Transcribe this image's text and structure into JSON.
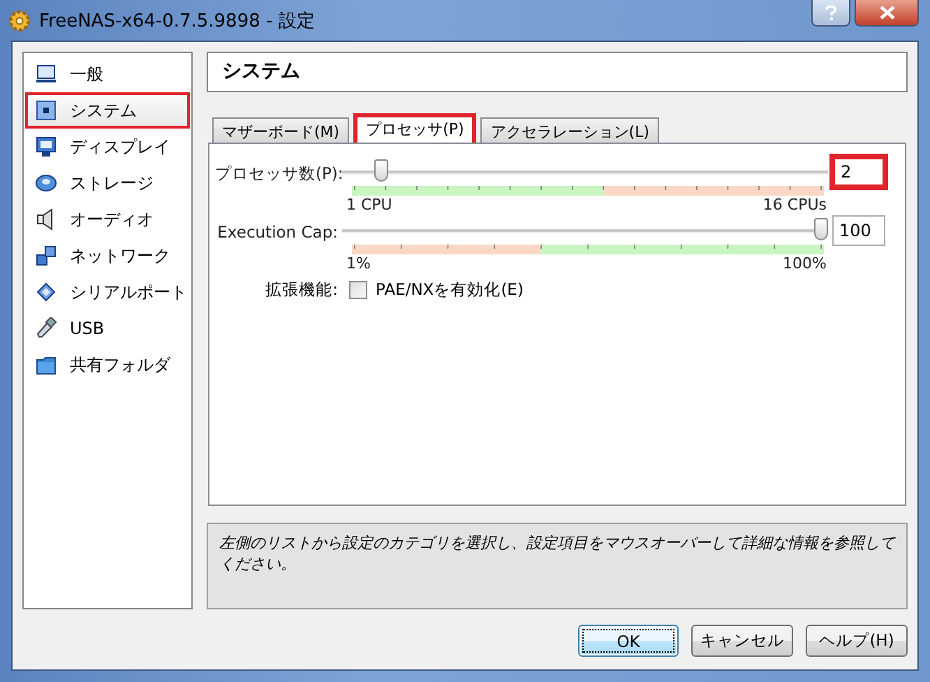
{
  "window": {
    "title": "FreeNAS-x64-0.7.5.9898 - 設定"
  },
  "sidebar": {
    "items": [
      {
        "label": "一般",
        "selected": false,
        "highlighted": false
      },
      {
        "label": "システム",
        "selected": true,
        "highlighted": true
      },
      {
        "label": "ディスプレイ",
        "selected": false,
        "highlighted": false
      },
      {
        "label": "ストレージ",
        "selected": false,
        "highlighted": false
      },
      {
        "label": "オーディオ",
        "selected": false,
        "highlighted": false
      },
      {
        "label": "ネットワーク",
        "selected": false,
        "highlighted": false
      },
      {
        "label": "シリアルポート",
        "selected": false,
        "highlighted": false
      },
      {
        "label": "USB",
        "selected": false,
        "highlighted": false
      },
      {
        "label": "共有フォルダ",
        "selected": false,
        "highlighted": false
      }
    ]
  },
  "page_title": "システム",
  "tabs": [
    {
      "label": "マザーボード(M)",
      "selected": false,
      "highlighted": false
    },
    {
      "label": "プロセッサ(P)",
      "selected": true,
      "highlighted": true
    },
    {
      "label": "アクセラレーション(L)",
      "selected": false,
      "highlighted": false
    }
  ],
  "processor": {
    "rows": [
      {
        "kind": "count",
        "label": "プロセッサ数(P):",
        "level": 0.067,
        "value": "2",
        "highlighted": true,
        "min_label": "1 CPU",
        "max_label": "16 CPUs"
      },
      {
        "kind": "percent",
        "label": "Execution Cap:",
        "level": 1,
        "value": "100",
        "highlighted": false,
        "min_label": "1%",
        "max_label": "100%"
      }
    ],
    "extended": {
      "label": "拡張機能:",
      "option": "PAE/NXを有効化(E)",
      "checked": false
    }
  },
  "description": "左側のリストから設定のカテゴリを選択し、設定項目をマウスオーバーして詳細な情報を参照してください。",
  "buttons": [
    {
      "label": "OK",
      "default": true
    },
    {
      "label": "キャンセル",
      "default": false
    },
    {
      "label": "ヘルプ(H)",
      "default": false
    }
  ]
}
